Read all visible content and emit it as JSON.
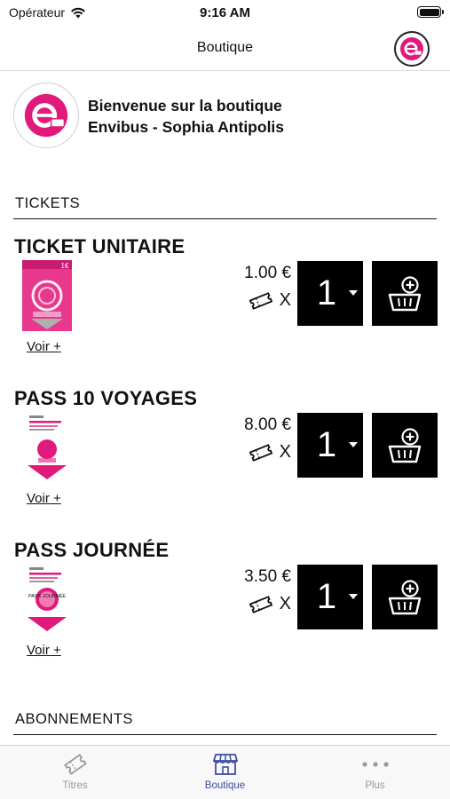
{
  "status": {
    "carrier": "Opérateur",
    "time": "9:16 AM"
  },
  "nav": {
    "title": "Boutique",
    "logo_icon": "envibus-logo-icon"
  },
  "welcome": {
    "line1": "Bienvenue sur la boutique",
    "line2": "Envibus - Sophia Antipolis"
  },
  "sections": {
    "tickets": "TICKETS",
    "abonnements": "ABONNEMENTS"
  },
  "products": [
    {
      "title": "TICKET UNITAIRE",
      "price": "1.00 €",
      "x_label": "X",
      "qty": "1",
      "link": "Voir +",
      "thumb_text": "1€"
    },
    {
      "title": "PASS 10 VOYAGES",
      "price": "8.00 €",
      "x_label": "X",
      "qty": "1",
      "link": "Voir +"
    },
    {
      "title": "PASS JOURNÉE",
      "price": "3.50 €",
      "x_label": "X",
      "qty": "1",
      "link": "Voir +",
      "thumb_text": "PASS JOURNÉE"
    }
  ],
  "tabs": [
    {
      "label": "Titres",
      "icon": "ticket-icon",
      "active": false
    },
    {
      "label": "Boutique",
      "icon": "shop-icon",
      "active": true
    },
    {
      "label": "Plus",
      "icon": "more-dots-icon",
      "active": false
    }
  ],
  "colors": {
    "brand_pink": "#e2197c",
    "active_tab": "#3b4ea0",
    "button_bg": "#000000"
  }
}
